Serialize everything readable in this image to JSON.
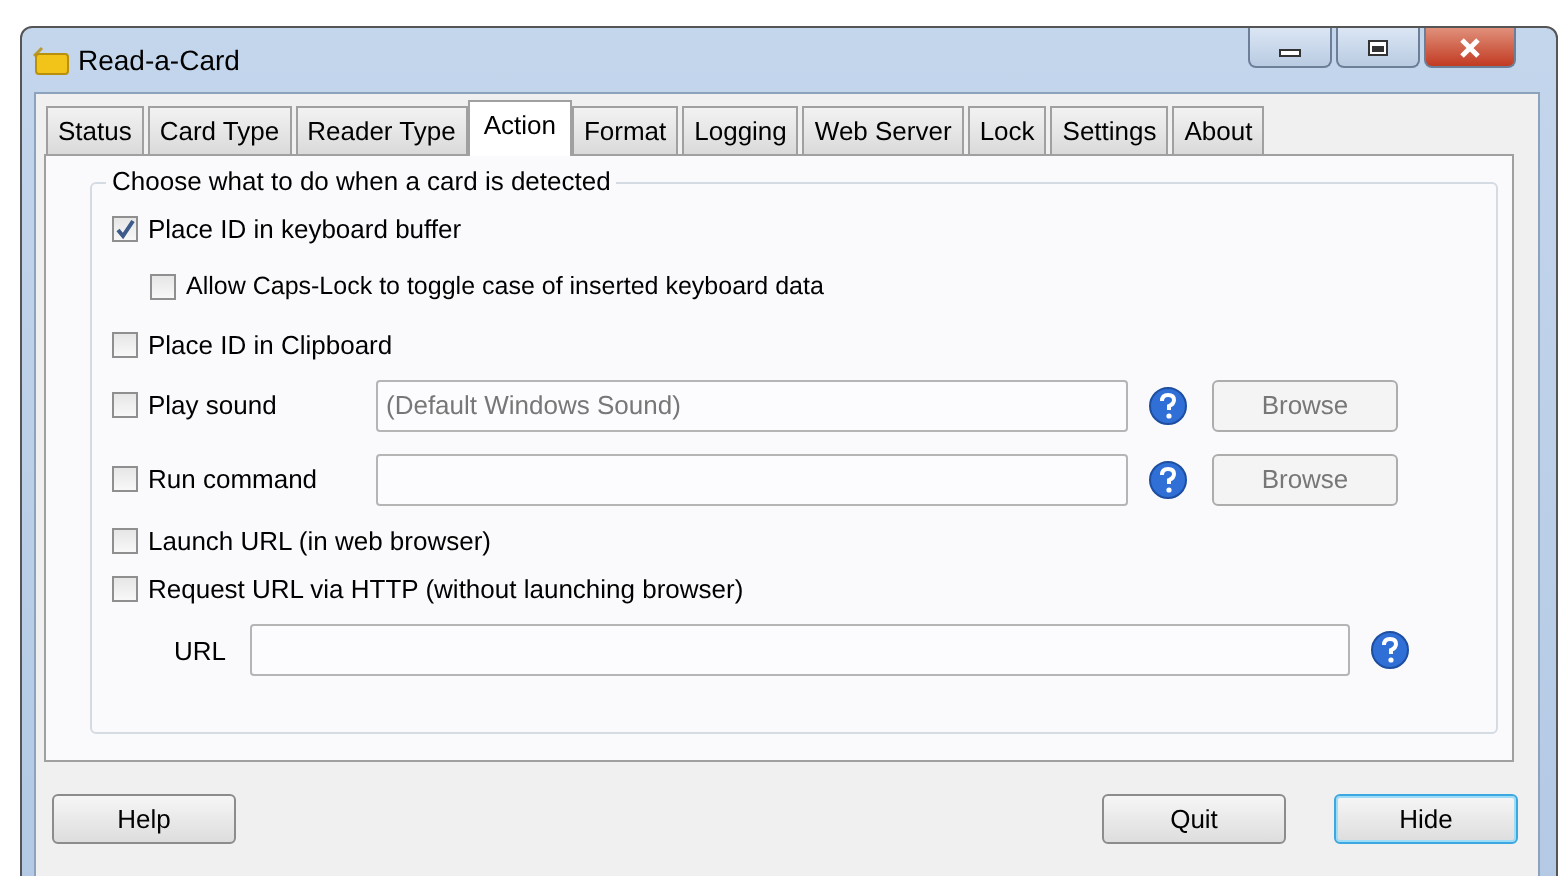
{
  "window": {
    "title": "Read-a-Card"
  },
  "tabs": [
    {
      "label": "Status",
      "selected": false
    },
    {
      "label": "Card Type",
      "selected": false
    },
    {
      "label": "Reader Type",
      "selected": false
    },
    {
      "label": "Action",
      "selected": true
    },
    {
      "label": "Format",
      "selected": false
    },
    {
      "label": "Logging",
      "selected": false
    },
    {
      "label": "Web Server",
      "selected": false
    },
    {
      "label": "Lock",
      "selected": false
    },
    {
      "label": "Settings",
      "selected": false
    },
    {
      "label": "About",
      "selected": false
    }
  ],
  "group": {
    "title": "Choose what to do when a card is detected",
    "options": [
      {
        "kind": "check",
        "label": "Place ID in keyboard buffer",
        "checked": true,
        "children": [
          {
            "label": "Allow Caps-Lock to toggle case of inserted keyboard data",
            "checked": false
          }
        ]
      },
      {
        "kind": "check",
        "label": "Place ID in Clipboard",
        "checked": false
      },
      {
        "kind": "file",
        "label": "Play sound",
        "checked": false,
        "placeholder": "(Default Windows Sound)",
        "button": "Browse",
        "button_disabled": true
      },
      {
        "kind": "file",
        "label": "Run command",
        "checked": false,
        "button": "Browse",
        "button_disabled": true
      },
      {
        "kind": "check",
        "label": "Launch URL (in web browser)",
        "checked": false
      },
      {
        "kind": "check",
        "label": "Request URL via HTTP (without launching browser)",
        "checked": false
      },
      {
        "kind": "url",
        "label": "URL"
      }
    ]
  },
  "buttons": [
    {
      "label": "Help",
      "default": false
    },
    {
      "label": "Quit",
      "default": false
    },
    {
      "label": "Hide",
      "default": true
    }
  ]
}
